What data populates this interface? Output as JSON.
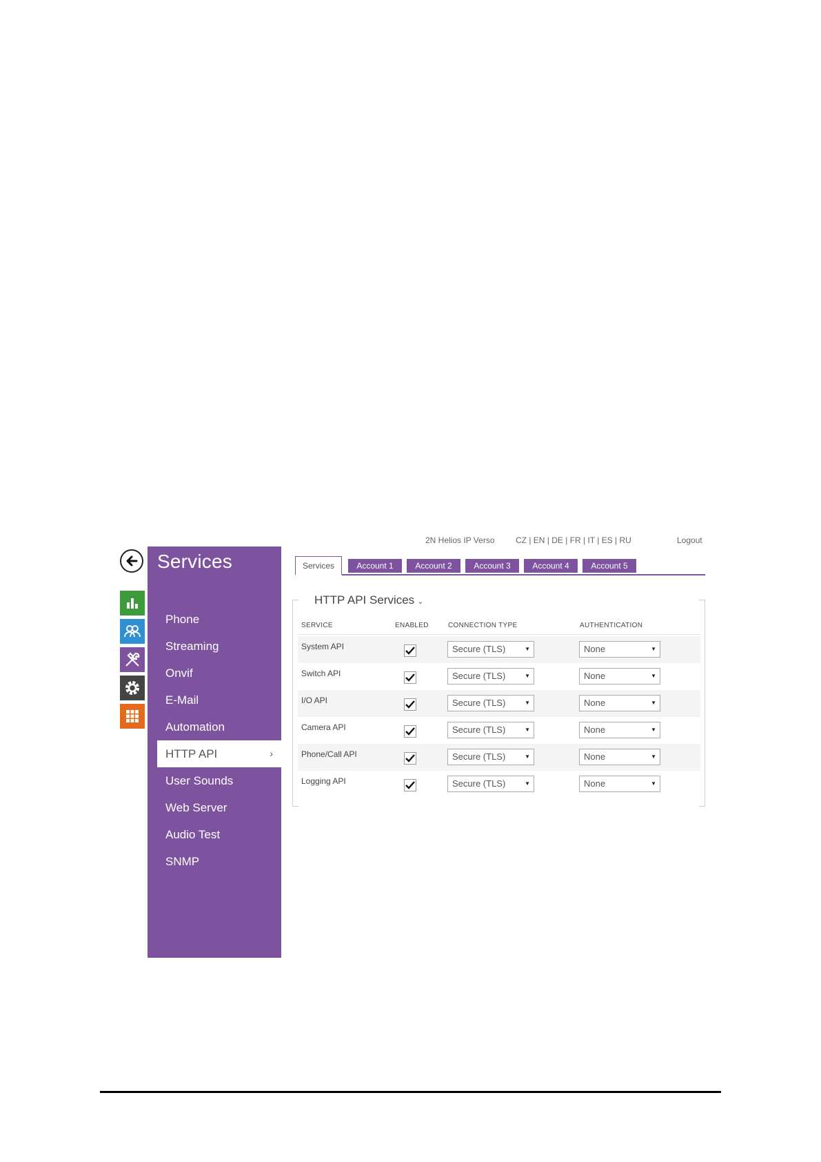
{
  "header": {
    "device_name": "2N Helios IP Verso",
    "languages": "CZ | EN | DE | FR | IT | ES | RU",
    "logout": "Logout"
  },
  "sidebar": {
    "title": "Services",
    "items": [
      {
        "label": "Phone"
      },
      {
        "label": "Streaming"
      },
      {
        "label": "Onvif"
      },
      {
        "label": "E-Mail"
      },
      {
        "label": "Automation"
      },
      {
        "label": "HTTP API",
        "active": true,
        "chevron": "›"
      },
      {
        "label": "User Sounds"
      },
      {
        "label": "Web Server"
      },
      {
        "label": "Audio Test"
      },
      {
        "label": "SNMP"
      }
    ]
  },
  "rail": {
    "icons": [
      "back-arrow-icon",
      "status-chart-icon",
      "directory-users-icon",
      "hardware-tools-icon",
      "system-gear-icon",
      "services-grid-icon"
    ],
    "colors": {
      "status": "#3c9a3a",
      "directory": "#2f8fd1",
      "hardware": "#7d529f",
      "system": "#444444",
      "services": "#e36b1e"
    }
  },
  "tabs": [
    "Services",
    "Account 1",
    "Account 2",
    "Account 3",
    "Account 4",
    "Account 5"
  ],
  "section": {
    "title": "HTTP API Services",
    "columns": {
      "service": "SERVICE",
      "enabled": "ENABLED",
      "connection": "CONNECTION TYPE",
      "auth": "AUTHENTICATION"
    },
    "rows": [
      {
        "name": "System API",
        "enabled": true,
        "connection": "Secure (TLS)",
        "auth": "None"
      },
      {
        "name": "Switch API",
        "enabled": true,
        "connection": "Secure (TLS)",
        "auth": "None"
      },
      {
        "name": "I/O API",
        "enabled": true,
        "connection": "Secure (TLS)",
        "auth": "None"
      },
      {
        "name": "Camera API",
        "enabled": true,
        "connection": "Secure (TLS)",
        "auth": "None"
      },
      {
        "name": "Phone/Call API",
        "enabled": true,
        "connection": "Secure (TLS)",
        "auth": "None"
      },
      {
        "name": "Logging API",
        "enabled": true,
        "connection": "Secure (TLS)",
        "auth": "None"
      }
    ]
  },
  "accent_color": "#7d529f"
}
